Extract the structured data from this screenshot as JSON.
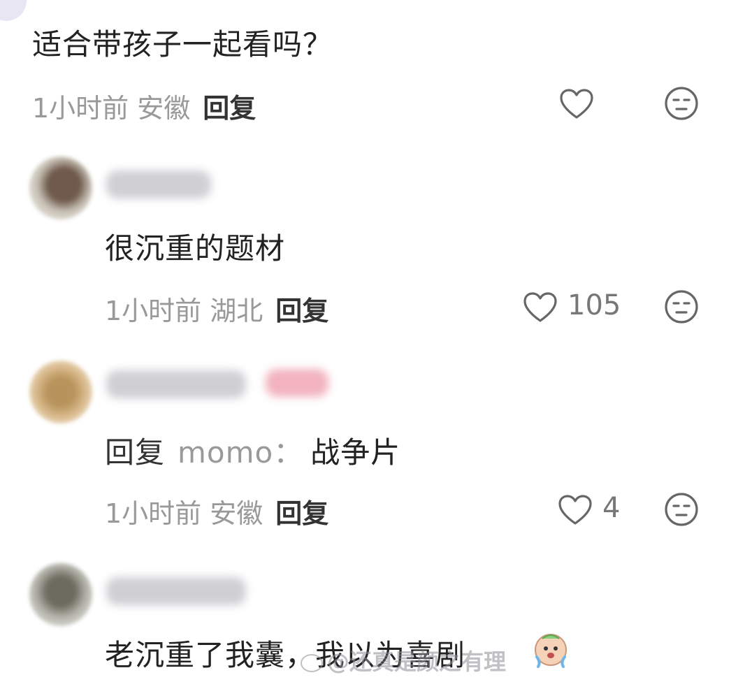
{
  "top_comment": {
    "text": "适合带孩子一起看吗？",
    "meta": "1小时前 安徽",
    "reply_label": "回复"
  },
  "comments": [
    {
      "text": "很沉重的题材",
      "meta": "1小时前 湖北",
      "reply_label": "回复",
      "likes": "105"
    },
    {
      "reply_prefix": "回复",
      "reply_target": "momo：",
      "text": "战争片",
      "meta": "1小时前 安徽",
      "reply_label": "回复",
      "likes": "4"
    },
    {
      "text": "老沉重了我囊，我以为喜剧"
    }
  ],
  "watermark": "@还真是颜之有理",
  "icons": {
    "like": "heart-outline-icon",
    "dislike": "neutral-face-icon",
    "emoji": "crying-emoji-icon",
    "weibo": "weibo-logo-icon"
  },
  "colors": {
    "text": "#222222",
    "meta": "#999999",
    "reply": "#333333",
    "icon": "#666666"
  }
}
